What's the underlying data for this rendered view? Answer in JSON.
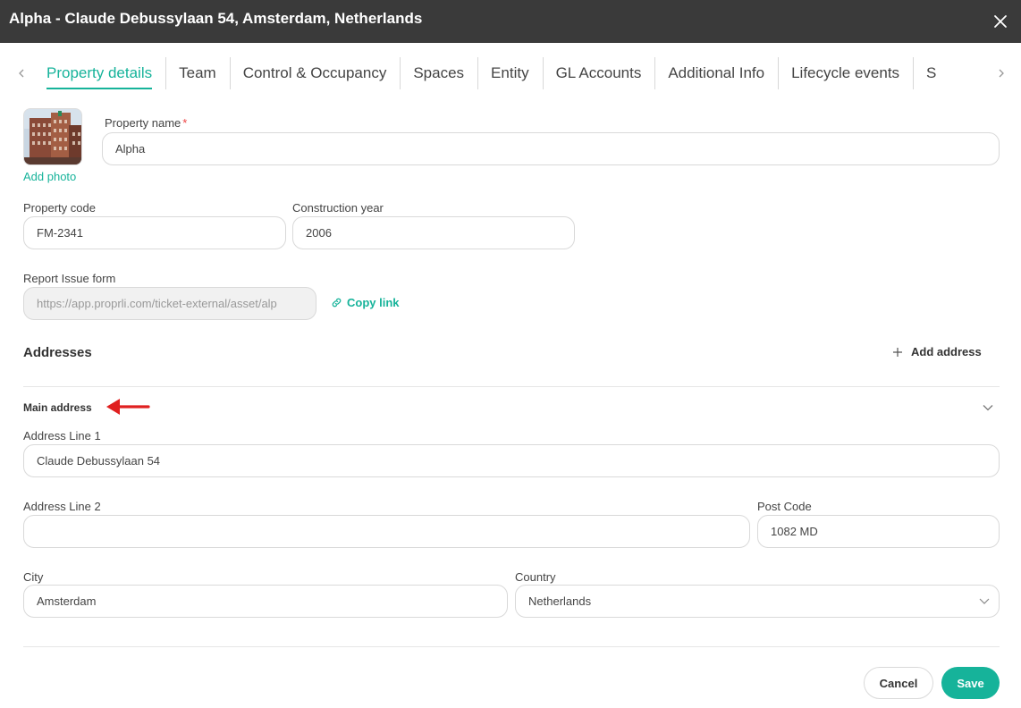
{
  "header": {
    "title": "Alpha - Claude Debussylaan 54, Amsterdam, Netherlands"
  },
  "tabs": [
    {
      "label": "Property details",
      "active": true
    },
    {
      "label": "Team",
      "active": false
    },
    {
      "label": "Control & Occupancy",
      "active": false
    },
    {
      "label": "Spaces",
      "active": false
    },
    {
      "label": "Entity",
      "active": false
    },
    {
      "label": "GL Accounts",
      "active": false
    },
    {
      "label": "Additional Info",
      "active": false
    },
    {
      "label": "Lifecycle events",
      "active": false
    },
    {
      "label": "S",
      "active": false
    }
  ],
  "photo": {
    "add_label": "Add photo"
  },
  "form": {
    "property_name_label": "Property name",
    "property_name_required": "*",
    "property_name_value": "Alpha",
    "property_code_label": "Property code",
    "property_code_value": "FM-2341",
    "construction_year_label": "Construction year",
    "construction_year_value": "2006",
    "report_issue_label": "Report Issue form",
    "report_issue_value": "https://app.proprli.com/ticket-external/asset/alp",
    "copy_link_label": "Copy link"
  },
  "addresses": {
    "title": "Addresses",
    "add_label": "Add address",
    "main_title": "Main address",
    "line1_label": "Address Line 1",
    "line1_value": "Claude Debussylaan 54",
    "line2_label": "Address Line 2",
    "line2_value": "",
    "postcode_label": "Post Code",
    "postcode_value": "1082 MD",
    "city_label": "City",
    "city_value": "Amsterdam",
    "country_label": "Country",
    "country_value": "Netherlands"
  },
  "footer": {
    "cancel_label": "Cancel",
    "save_label": "Save"
  },
  "colors": {
    "accent": "#16b39a",
    "header_bg": "#3a3a3a",
    "required": "#e44444",
    "annotation_arrow": "#e02020"
  }
}
